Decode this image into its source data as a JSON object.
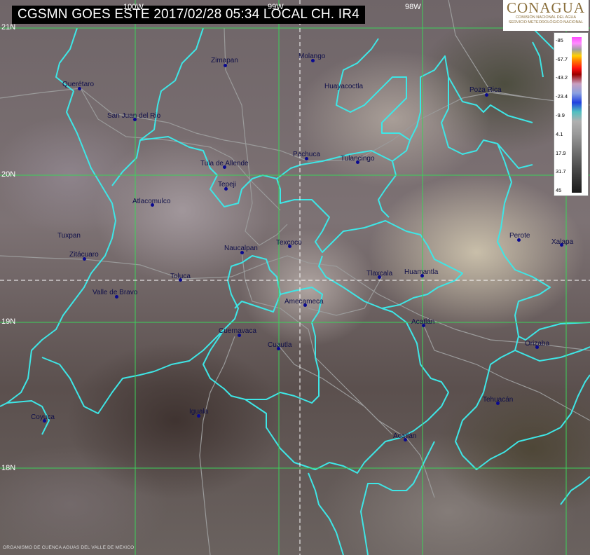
{
  "header": {
    "title": "CGSMN GOES ESTE 2017/02/28 05:34 LOCAL  CH. IR4"
  },
  "grid": {
    "latitudes": [
      "21N",
      "20N",
      "19N",
      "18N"
    ],
    "longitudes": [
      "100W",
      "99W",
      "98W"
    ]
  },
  "cities": [
    {
      "name": "Zimapan"
    },
    {
      "name": "Molango"
    },
    {
      "name": "Querétaro"
    },
    {
      "name": "Huayacoctla"
    },
    {
      "name": "Poza Rica"
    },
    {
      "name": "San Juan del Rio"
    },
    {
      "name": "Pachuca"
    },
    {
      "name": "Tulancingo"
    },
    {
      "name": "Tula de Allende"
    },
    {
      "name": "Tepeji"
    },
    {
      "name": "Atlacomulco"
    },
    {
      "name": "Perote"
    },
    {
      "name": "Xalapa"
    },
    {
      "name": "Tuxpan"
    },
    {
      "name": "Texcoco"
    },
    {
      "name": "Naucalpan"
    },
    {
      "name": "Zitácuaro"
    },
    {
      "name": "Tlaxcala"
    },
    {
      "name": "Huamantla"
    },
    {
      "name": "Toluca"
    },
    {
      "name": "Valle de Bravo"
    },
    {
      "name": "Amecameca"
    },
    {
      "name": "Acatlán"
    },
    {
      "name": "Cuernavaca"
    },
    {
      "name": "Cuautla"
    },
    {
      "name": "Orizaba"
    },
    {
      "name": "Tehuacán"
    },
    {
      "name": "Coyuca"
    },
    {
      "name": "Iguala"
    },
    {
      "name": "Acatlán"
    }
  ],
  "logo": {
    "name": "CONAGUA",
    "line1": "COMISIÓN NACIONAL DEL AGUA",
    "line2": "SERVICIO METEOROLÓGICO NACIONAL"
  },
  "legend": {
    "ticks": [
      "-85",
      "-67.7",
      "-43.2",
      "-23.4",
      "-9.9",
      "4.1",
      "17.9",
      "31.7",
      "45"
    ]
  },
  "footer": {
    "text": "ORGANISMO DE CUENCA AGUAS DEL VALLE DE MEXICO"
  },
  "colors": {
    "borders": "#3ee6e6",
    "grid": "#3cd25a",
    "roads": "#9a9a9a",
    "city_dot": "#0a0a90"
  }
}
